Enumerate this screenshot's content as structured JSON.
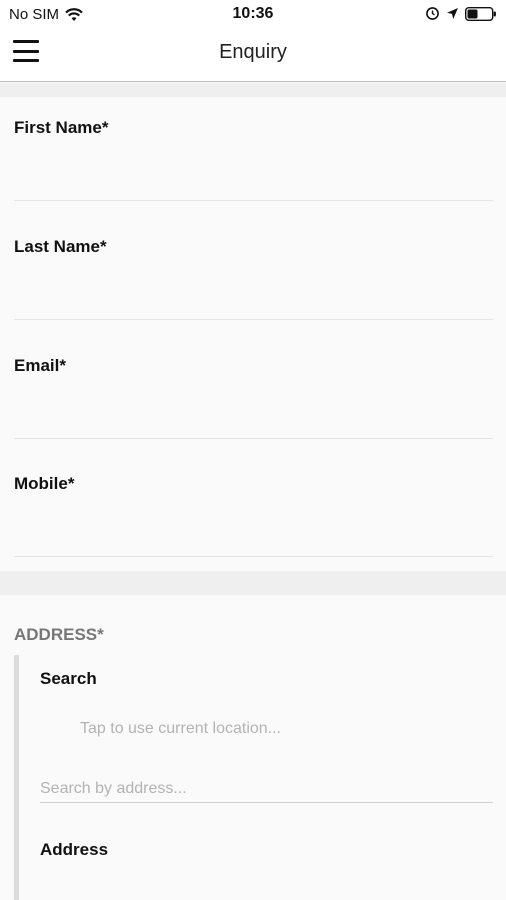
{
  "status_bar": {
    "carrier": "No SIM",
    "time": "10:36",
    "icons": [
      "wifi-icon",
      "alarm-icon",
      "location-arrow-icon",
      "battery-icon"
    ]
  },
  "nav": {
    "title": "Enquiry",
    "menu_icon": "hamburger-menu-icon"
  },
  "form": {
    "fields": [
      {
        "label": "First Name*",
        "value": ""
      },
      {
        "label": "Last Name*",
        "value": ""
      },
      {
        "label": "Email*",
        "value": ""
      },
      {
        "label": "Mobile*",
        "value": ""
      }
    ]
  },
  "address": {
    "heading": "ADDRESS*",
    "search_label": "Search",
    "current_location": "Tap to use current location...",
    "search_placeholder": "Search by address...",
    "address_label": "Address"
  },
  "colors": {
    "background": "#fafafa",
    "separator": "#efefef",
    "heading_gray": "#777777",
    "placeholder": "#b3b3b3"
  }
}
